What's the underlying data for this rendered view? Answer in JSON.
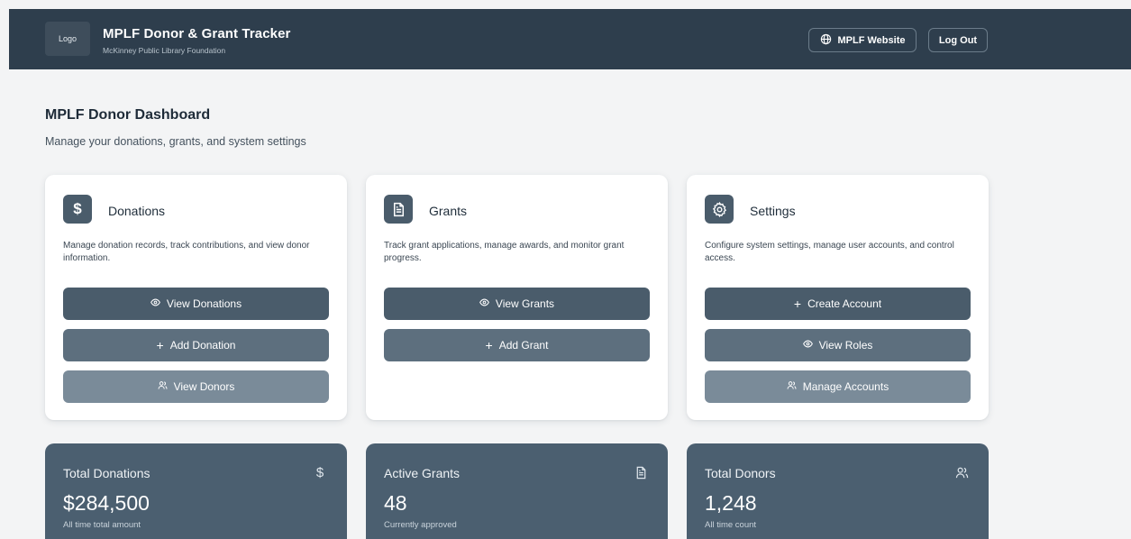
{
  "header": {
    "logo_text": "Logo",
    "title": "MPLF Donor & Grant Tracker",
    "subtitle": "McKinney Public Library Foundation",
    "website_label": "MPLF Website",
    "logout_label": "Log Out"
  },
  "page": {
    "title": "MPLF Donor Dashboard",
    "subtitle": "Manage your donations, grants, and system settings"
  },
  "cards": [
    {
      "title": "Donations",
      "icon": "dollar-icon",
      "description": "Manage donation records, track contributions, and view donor information.",
      "buttons": [
        {
          "label": "View Donations",
          "icon": "eye-icon"
        },
        {
          "label": "Add Donation",
          "icon": "plus-icon"
        },
        {
          "label": "View Donors",
          "icon": "users-icon"
        }
      ]
    },
    {
      "title": "Grants",
      "icon": "document-icon",
      "description": "Track grant applications, manage awards, and monitor grant progress.",
      "buttons": [
        {
          "label": "View Grants",
          "icon": "eye-icon"
        },
        {
          "label": "Add Grant",
          "icon": "plus-icon"
        }
      ]
    },
    {
      "title": "Settings",
      "icon": "gear-icon",
      "description": "Configure system settings, manage user accounts, and control access.",
      "buttons": [
        {
          "label": "Create Account",
          "icon": "plus-icon"
        },
        {
          "label": "View Roles",
          "icon": "eye-icon"
        },
        {
          "label": "Manage Accounts",
          "icon": "users-icon"
        }
      ]
    }
  ],
  "stats": [
    {
      "label": "Total Donations",
      "value": "$284,500",
      "note": "All time total amount",
      "icon": "dollar-icon"
    },
    {
      "label": "Active Grants",
      "value": "48",
      "note": "Currently approved",
      "icon": "document-icon"
    },
    {
      "label": "Total Donors",
      "value": "1,248",
      "note": "All time count",
      "icon": "users-icon"
    }
  ],
  "colors": {
    "header_bg": "#2e3e4d",
    "page_bg": "#f3f4f5",
    "primary_button": "#4a5c6b",
    "secondary_button": "#5d6f7e",
    "tertiary_button": "#7a8b99",
    "stat_card_bg": "#4b5f70"
  }
}
